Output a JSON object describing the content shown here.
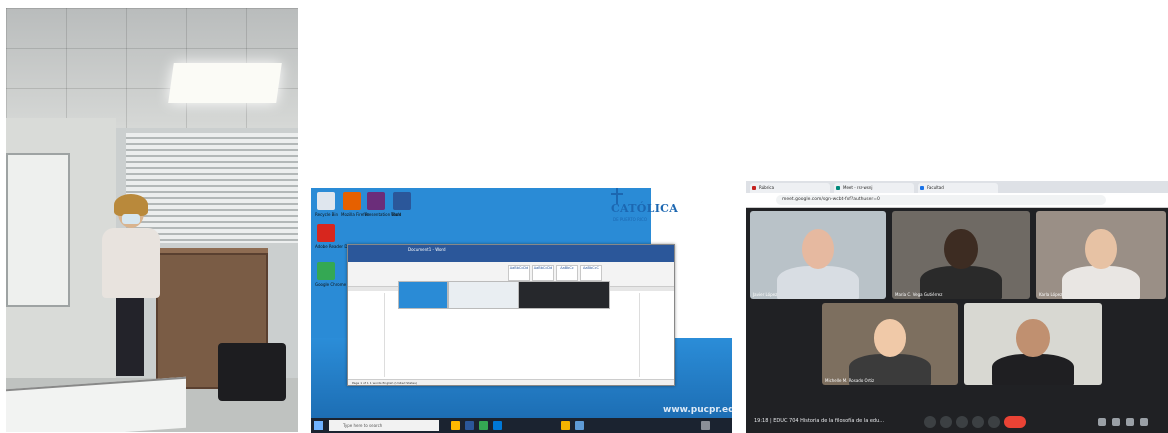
{
  "panel2": {
    "logo_text": "CATÓLICA",
    "logo_subtext": "DE PUERTO RICO",
    "website": "www.pucpr.edu",
    "desktop_icons": [
      {
        "label": "Recycle Bin",
        "color": "#dfe6ee",
        "icon": "recycle-bin-icon"
      },
      {
        "label": "Mozilla Firefox",
        "color": "#e66000",
        "icon": "firefox-icon"
      },
      {
        "label": "Presentation Tools",
        "color": "#6b2d7a",
        "icon": "presentation-icon"
      },
      {
        "label": "Word",
        "color": "#2b579a",
        "icon": "word-icon"
      },
      {
        "label": "Adobe Reader DC",
        "color": "#d7261e",
        "icon": "adobe-reader-icon"
      },
      {
        "label": "Google Chrome",
        "color": "#34a853",
        "icon": "chrome-icon"
      }
    ],
    "word": {
      "title": "Document1 - Word",
      "tabs": [
        "File",
        "Home",
        "Insert",
        "Draw",
        "Design",
        "Layout",
        "References",
        "Mailings",
        "Review",
        "View",
        "Help"
      ],
      "styles": [
        "AaBbCcDd",
        "AaBbCcDd",
        "AaBbCc",
        "AaBbCcC"
      ],
      "status": "Page 1 of 1   1 words   English (United States)"
    },
    "taskbar": {
      "search_placeholder": "Type here to search"
    }
  },
  "panel3": {
    "tabs": [
      "Rúbrica",
      "Meet - rsr-wsnj",
      "Facultad"
    ],
    "url": "meet.google.com/sgn-wcbt-fxf?authuser=0",
    "participants": [
      {
        "name": "Javier López",
        "bg": "#b9c2c8",
        "skin": "#e6b9a0",
        "shirt": "#d8dde3"
      },
      {
        "name": "María C. Vega Gutiérrez",
        "bg": "#6f6a64",
        "skin": "#3d2c22",
        "shirt": "#2a2a2a"
      },
      {
        "name": "Karla López",
        "bg": "#9a8f86",
        "skin": "#e7c2a4",
        "shirt": "#e9e6e3"
      },
      {
        "name": "Michelle M. Rosado Ortiz",
        "bg": "#7d6f5f",
        "skin": "#f0c9a8",
        "shirt": "#3b3b3b"
      },
      {
        "name": "",
        "bg": "#d8d8d2",
        "skin": "#c09070",
        "shirt": "#1f1f22"
      }
    ],
    "meeting_info": "19:18  |  EDUC 704 Historia de la filosofía de la edu..."
  }
}
